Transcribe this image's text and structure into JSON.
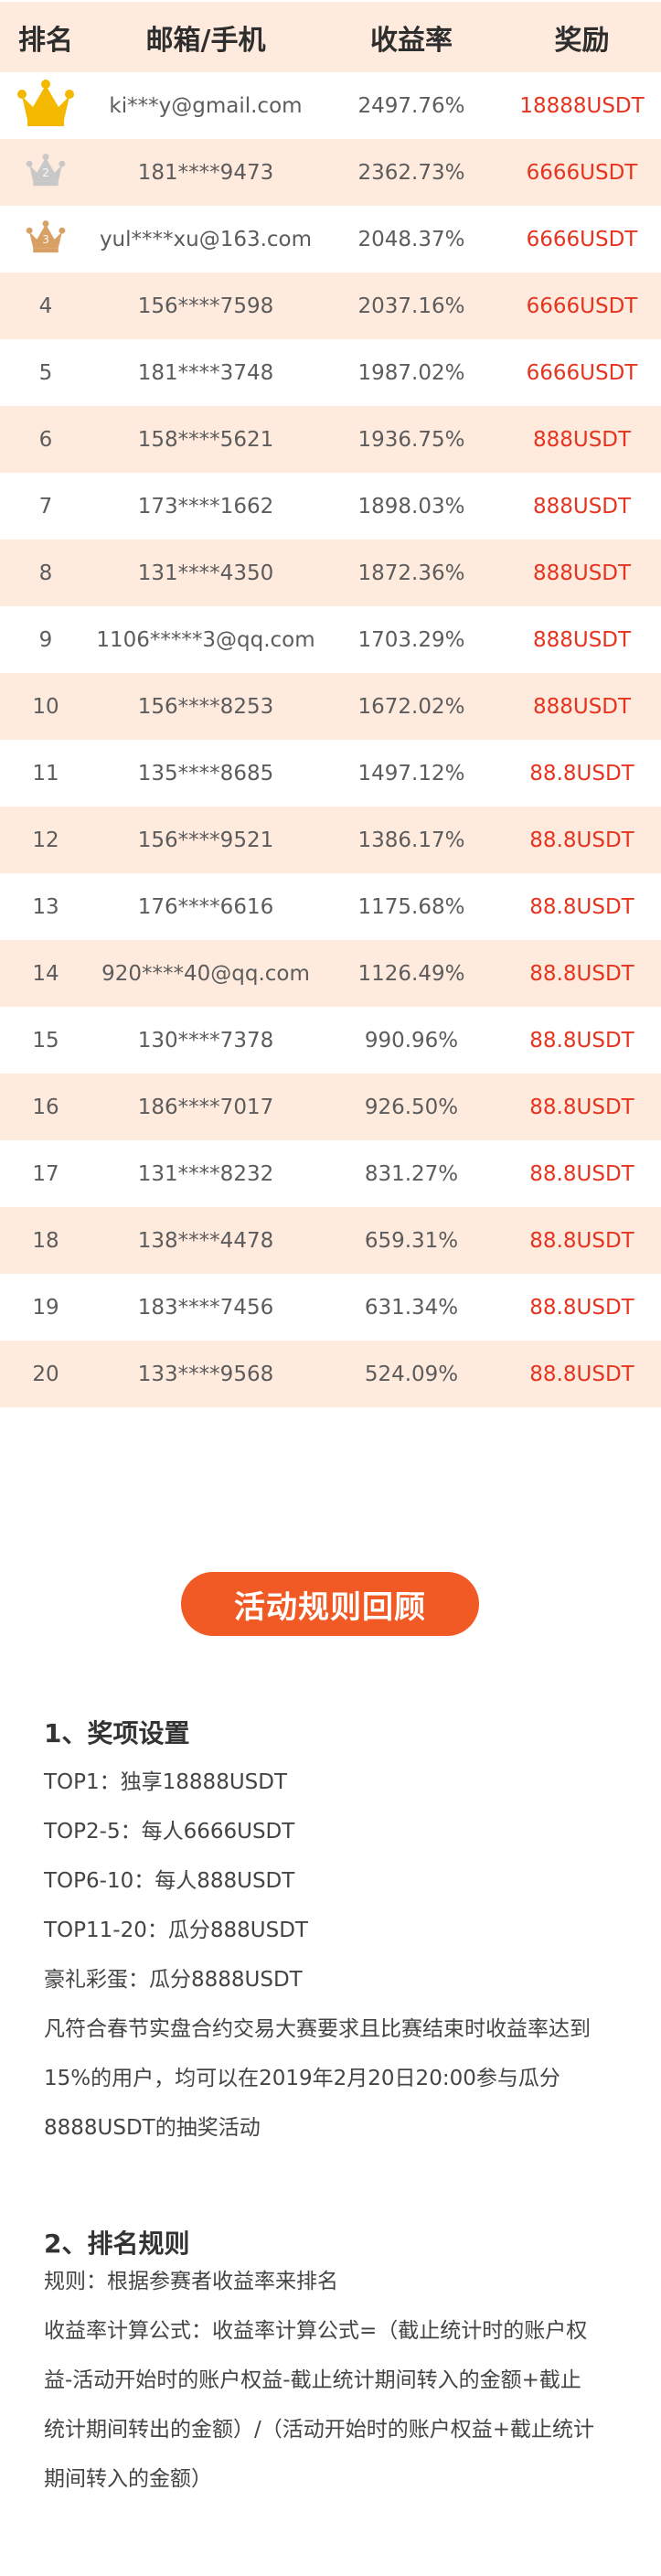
{
  "table": {
    "headers": {
      "rank": "排名",
      "account": "邮箱/手机",
      "yield": "收益率",
      "reward": "奖励"
    },
    "rows": [
      {
        "rank": "1",
        "account": "ki***y@gmail.com",
        "yield": "2497.76%",
        "reward": "18888USDT",
        "medal": "gold-crown-icon"
      },
      {
        "rank": "2",
        "account": "181****9473",
        "yield": "2362.73%",
        "reward": "6666USDT",
        "medal": "silver-crown-icon"
      },
      {
        "rank": "3",
        "account": "yul****xu@163.com",
        "yield": "2048.37%",
        "reward": "6666USDT",
        "medal": "bronze-crown-icon"
      },
      {
        "rank": "4",
        "account": "156****7598",
        "yield": "2037.16%",
        "reward": "6666USDT"
      },
      {
        "rank": "5",
        "account": "181****3748",
        "yield": "1987.02%",
        "reward": "6666USDT"
      },
      {
        "rank": "6",
        "account": "158****5621",
        "yield": "1936.75%",
        "reward": "888USDT"
      },
      {
        "rank": "7",
        "account": "173****1662",
        "yield": "1898.03%",
        "reward": "888USDT"
      },
      {
        "rank": "8",
        "account": "131****4350",
        "yield": "1872.36%",
        "reward": "888USDT"
      },
      {
        "rank": "9",
        "account": "1106*****3@qq.com",
        "yield": "1703.29%",
        "reward": "888USDT"
      },
      {
        "rank": "10",
        "account": "156****8253",
        "yield": "1672.02%",
        "reward": "888USDT"
      },
      {
        "rank": "11",
        "account": "135****8685",
        "yield": "1497.12%",
        "reward": "88.8USDT"
      },
      {
        "rank": "12",
        "account": "156****9521",
        "yield": "1386.17%",
        "reward": "88.8USDT"
      },
      {
        "rank": "13",
        "account": "176****6616",
        "yield": "1175.68%",
        "reward": "88.8USDT"
      },
      {
        "rank": "14",
        "account": "920****40@qq.com",
        "yield": "1126.49%",
        "reward": "88.8USDT"
      },
      {
        "rank": "15",
        "account": "130****7378",
        "yield": "990.96%",
        "reward": "88.8USDT"
      },
      {
        "rank": "16",
        "account": "186****7017",
        "yield": "926.50%",
        "reward": "88.8USDT"
      },
      {
        "rank": "17",
        "account": "131****8232",
        "yield": "831.27%",
        "reward": "88.8USDT"
      },
      {
        "rank": "18",
        "account": "138****4478",
        "yield": "659.31%",
        "reward": "88.8USDT"
      },
      {
        "rank": "19",
        "account": "183****7456",
        "yield": "631.34%",
        "reward": "88.8USDT"
      },
      {
        "rank": "20",
        "account": "133****9568",
        "yield": "524.09%",
        "reward": "88.8USDT"
      }
    ]
  },
  "rules_button": "活动规则回顾",
  "section1": {
    "title": "1、奖项设置",
    "lines": [
      "TOP1：独享18888USDT",
      "TOP2-5：每人6666USDT",
      "TOP6-10：每人888USDT",
      "TOP11-20：瓜分888USDT",
      "豪礼彩蛋：瓜分8888USDT"
    ],
    "paragraph_lines": [
      "凡符合春节实盘合约交易大赛要求且比赛结束时收益率达到",
      "15%的用户，均可以在2019年2月20日20:00参与瓜分",
      "8888USDT的抽奖活动"
    ]
  },
  "section2": {
    "title": "2、排名规则",
    "lines": [
      "规则：根据参赛者收益率来排名"
    ],
    "paragraph_lines": [
      "收益率计算公式：收益率计算公式=（截止统计时的账户权",
      "益-活动开始时的账户权益-截止统计期间转入的金额+截止",
      "统计期间转出的金额）/（活动开始时的账户权益+截止统计",
      "期间转入的金额）"
    ]
  },
  "colors": {
    "header_bg": "#ffeade",
    "row_alt_bg": "#ffeade",
    "reward_text": "#e5341f",
    "button_bg": "#f15a24",
    "gold": "#f5b800",
    "silver": "#c8c8c8",
    "bronze": "#d9a066"
  }
}
